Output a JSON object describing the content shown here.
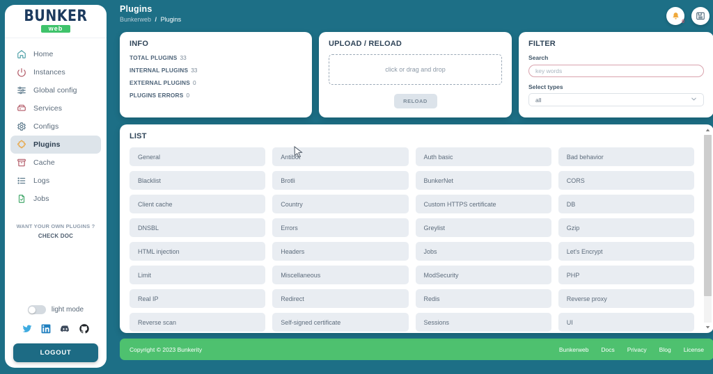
{
  "sidebar": {
    "logo": {
      "primary": "BUNKER",
      "badge": "web"
    },
    "items": [
      {
        "label": "Home",
        "icon": "home-icon"
      },
      {
        "label": "Instances",
        "icon": "power-icon"
      },
      {
        "label": "Global config",
        "icon": "sliders-icon"
      },
      {
        "label": "Services",
        "icon": "server-icon"
      },
      {
        "label": "Configs",
        "icon": "gear-icon"
      },
      {
        "label": "Plugins",
        "icon": "puzzle-icon"
      },
      {
        "label": "Cache",
        "icon": "archive-icon"
      },
      {
        "label": "Logs",
        "icon": "list-icon"
      },
      {
        "label": "Jobs",
        "icon": "file-check-icon"
      }
    ],
    "promo": {
      "question": "WANT YOUR OWN PLUGINS ?",
      "cta": "CHECK DOC"
    },
    "mode_toggle_label": "light mode",
    "socials": [
      "twitter-icon",
      "linkedin-icon",
      "discord-icon",
      "github-icon"
    ],
    "logout_label": "LOGOUT"
  },
  "header": {
    "title": "Plugins",
    "breadcrumb": {
      "root": "Bunkerweb",
      "separator": "/",
      "current": "Plugins"
    },
    "notifications": {
      "icon": "bell-icon",
      "count": "0"
    },
    "news": {
      "icon": "news-icon"
    }
  },
  "info": {
    "title": "INFO",
    "rows": [
      {
        "key": "TOTAL PLUGINS",
        "value": "33"
      },
      {
        "key": "INTERNAL PLUGINS",
        "value": "33"
      },
      {
        "key": "EXTERNAL PLUGINS",
        "value": "0"
      },
      {
        "key": "PLUGINS ERRORS",
        "value": "0"
      }
    ]
  },
  "upload": {
    "title": "UPLOAD / RELOAD",
    "dropzone_text": "click or drag and drop",
    "reload_label": "RELOAD"
  },
  "filter": {
    "title": "FILTER",
    "search_label": "Search",
    "search_placeholder": "key words",
    "search_value": "",
    "types_label": "Select types",
    "types_selected": "all"
  },
  "list": {
    "title": "LIST",
    "plugins": [
      "General",
      "Antibot",
      "Auth basic",
      "Bad behavior",
      "Blacklist",
      "Brotli",
      "BunkerNet",
      "CORS",
      "Client cache",
      "Country",
      "Custom HTTPS certificate",
      "DB",
      "DNSBL",
      "Errors",
      "Greylist",
      "Gzip",
      "HTML injection",
      "Headers",
      "Jobs",
      "Let's Encrypt",
      "Limit",
      "Miscellaneous",
      "ModSecurity",
      "PHP",
      "Real IP",
      "Redirect",
      "Redis",
      "Reverse proxy",
      "Reverse scan",
      "Self-signed certificate",
      "Sessions",
      "UI"
    ]
  },
  "footer": {
    "copyright": "Copyright © 2023 Bunkerity",
    "links": [
      "Bunkerweb",
      "Docs",
      "Privacy",
      "Blog",
      "License"
    ]
  },
  "colors": {
    "page_bg": "#1d6f86",
    "accent_green": "#4ec16f",
    "card_bg": "#ffffff",
    "plugin_item_bg": "#e9edf2",
    "active_nav_bg": "#dde4ea"
  }
}
